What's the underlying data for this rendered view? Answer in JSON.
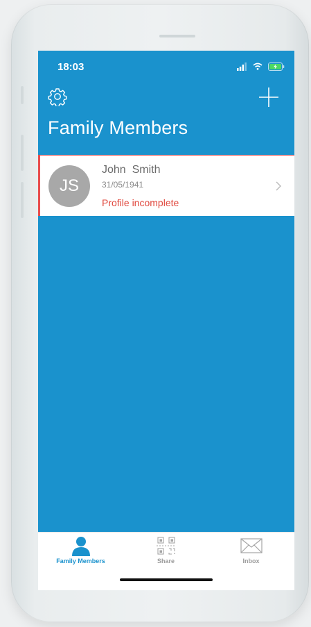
{
  "status_bar": {
    "time": "18:03",
    "signal_icon": "signal-bars-icon",
    "wifi_icon": "wifi-icon",
    "battery_icon": "battery-charging-icon"
  },
  "nav": {
    "settings_icon": "gear-icon",
    "add_icon": "plus-icon"
  },
  "page": {
    "title": "Family Members"
  },
  "members": [
    {
      "initials": "JS",
      "name": "John  Smith",
      "dob": "31/05/1941",
      "status": "Profile incomplete"
    }
  ],
  "tabs": [
    {
      "label": "Family Members",
      "icon": "person-icon",
      "active": true
    },
    {
      "label": "Share",
      "icon": "qr-code-icon",
      "active": false
    },
    {
      "label": "Inbox",
      "icon": "envelope-icon",
      "active": false
    }
  ],
  "colors": {
    "primary": "#1a92cd",
    "warning": "#e0483e",
    "avatar": "#a8a8a8"
  }
}
